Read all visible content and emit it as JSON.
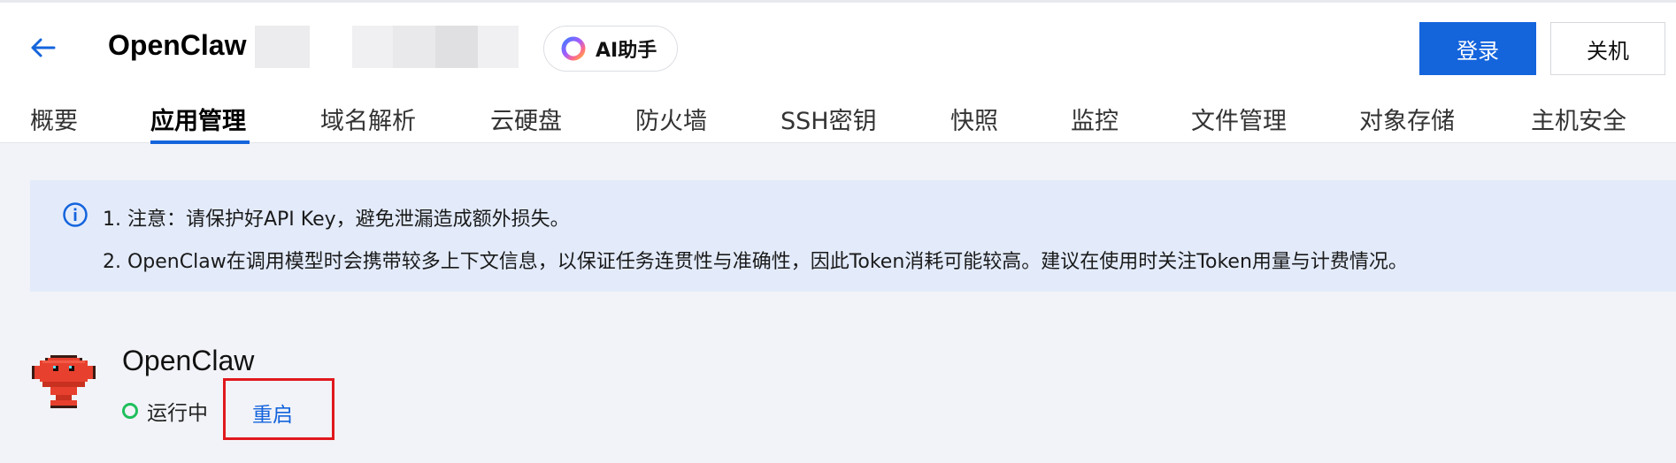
{
  "header": {
    "title": "OpenClaw",
    "ai_button_label": "AI助手",
    "login_label": "登录",
    "shutdown_label": "关机"
  },
  "tabs": [
    {
      "label": "概要"
    },
    {
      "label": "应用管理",
      "active": true
    },
    {
      "label": "域名解析"
    },
    {
      "label": "云硬盘"
    },
    {
      "label": "防火墙"
    },
    {
      "label": "SSH密钥"
    },
    {
      "label": "快照"
    },
    {
      "label": "监控"
    },
    {
      "label": "文件管理"
    },
    {
      "label": "对象存储"
    },
    {
      "label": "主机安全"
    }
  ],
  "notice": {
    "line1": "1. 注意：请保护好API Key，避免泄漏造成额外损失。",
    "line2": "2. OpenClaw在调用模型时会携带较多上下文信息，以保证任务连贯性与准确性，因此Token消耗可能较高。建议在使用时关注Token用量与计费情况。"
  },
  "app": {
    "name": "OpenClaw",
    "status": "运行中",
    "restart_label": "重启"
  },
  "colors": {
    "accent": "#1464dc",
    "status_running": "#1fbf5c",
    "highlight_box": "#e0181e",
    "notice_bg": "#e3ebfb"
  }
}
